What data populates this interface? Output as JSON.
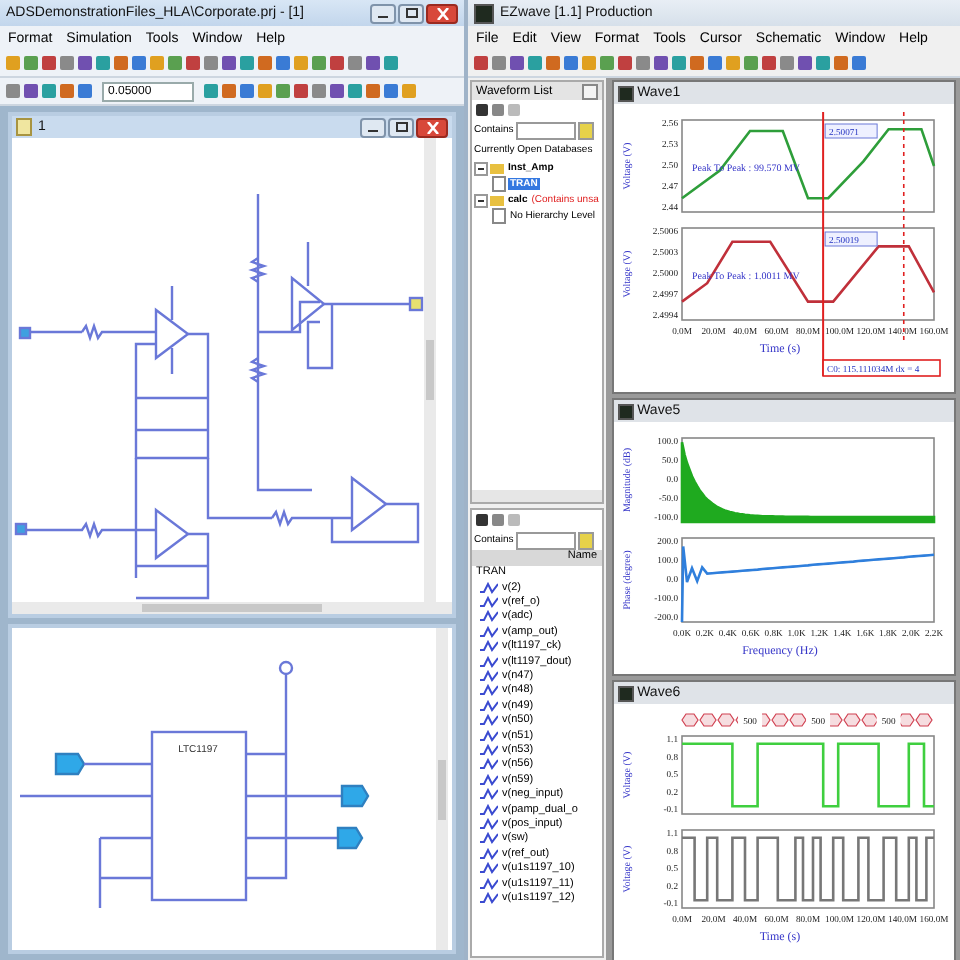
{
  "schematic_app": {
    "title": "ADSDemonstrationFiles_HLA\\Corporate.prj - [1]",
    "menu": [
      "Format",
      "Simulation",
      "Tools",
      "Window",
      "Help"
    ],
    "step_field": {
      "value": "0.05000"
    },
    "sheet_window": {
      "title": "1"
    },
    "chip_label": "LTC1197"
  },
  "ezwave": {
    "title": "EZwave [1.1] Production",
    "menu": [
      "File",
      "Edit",
      "View",
      "Format",
      "Tools",
      "Cursor",
      "Schematic",
      "Window",
      "Help"
    ],
    "waveform_list": {
      "title": "Waveform List",
      "contains_label": "Contains",
      "databases_label": "Currently Open Databases",
      "tree": [
        {
          "label": "Inst_Amp",
          "expanded": true,
          "selected": false,
          "children": [
            {
              "label": "TRAN",
              "selected": true
            }
          ]
        },
        {
          "label": "calc",
          "note": "(Contains unsa",
          "expanded": true,
          "selected": false,
          "children": [
            {
              "label": "No Hierarchy Level",
              "selected": false
            }
          ]
        }
      ]
    },
    "signal_list": {
      "contains_label": "Contains",
      "column": "Name",
      "group": "TRAN",
      "signals": [
        "v(2)",
        "v(ref_o)",
        "v(adc)",
        "v(amp_out)",
        "v(lt1197_ck)",
        "v(lt1197_dout)",
        "v(n47)",
        "v(n48)",
        "v(n49)",
        "v(n50)",
        "v(n51)",
        "v(n53)",
        "v(n56)",
        "v(n59)",
        "v(neg_input)",
        "v(pamp_dual_o",
        "v(pos_input)",
        "v(sw)",
        "v(ref_out)",
        "v(u1s1197_10)",
        "v(u1s1197_11)",
        "v(u1s1197_12)"
      ]
    },
    "waves": [
      {
        "kind": "transient",
        "title": "Wave1",
        "xticks": [
          "0.0M",
          "20.0M",
          "40.0M",
          "60.0M",
          "80.0M",
          "100.0M",
          "120.0M",
          "140.0M",
          "160.0M"
        ],
        "xlabel": "Time (s)",
        "cursor_readout": "C0: 115.111034M dx = 4",
        "panels": [
          {
            "ylabel": "Voltage (V)",
            "yticks": [
              "2.56",
              "2.53",
              "2.50",
              "2.47",
              "2.44"
            ],
            "measure": "Peak To Peak : 99.570 MV",
            "cursor_value": "2.50071",
            "color": "#2e9e3a"
          },
          {
            "ylabel": "Voltage (V)",
            "yticks": [
              "2.5006",
              "2.5003",
              "2.5000",
              "2.4997",
              "2.4994"
            ],
            "measure": "Peak To Peak : 1.0011 MV",
            "cursor_value": "2.50019",
            "color": "#c0303a"
          }
        ]
      },
      {
        "kind": "spectrum",
        "title": "Wave5",
        "xticks": [
          "0.0K",
          "0.2K",
          "0.4K",
          "0.6K",
          "0.8K",
          "1.0K",
          "1.2K",
          "1.4K",
          "1.6K",
          "1.8K",
          "2.0K",
          "2.2K"
        ],
        "xlabel": "Frequency (Hz)",
        "panels": [
          {
            "ylabel": "Magnitude (dB)",
            "yticks": [
              "100.0",
              "50.0",
              "0.0",
              "-50.0",
              "-100.0"
            ],
            "color": "#1faa1f"
          },
          {
            "ylabel": "Phase (degree)",
            "yticks": [
              "200.0",
              "100.0",
              "0.0",
              "-100.0",
              "-200.0"
            ],
            "color": "#2f7fdc"
          }
        ]
      },
      {
        "kind": "digital",
        "title": "Wave6",
        "xticks": [
          "0.0M",
          "20.0M",
          "40.0M",
          "60.0M",
          "80.0M",
          "100.0M",
          "120.0M",
          "140.0M",
          "160.0M"
        ],
        "xlabel": "Time (s)",
        "bus_labels": [
          "500",
          "500",
          "500"
        ],
        "panels": [
          {
            "ylabel": "Voltage (V)",
            "yticks": [
              "1.1",
              "0.8",
              "0.5",
              "0.2",
              "-0.1"
            ],
            "color": "#3fcf3f"
          },
          {
            "ylabel": "Voltage (V)",
            "yticks": [
              "1.1",
              "0.8",
              "0.5",
              "0.2",
              "-0.1"
            ],
            "color": "#777777"
          }
        ]
      }
    ]
  }
}
